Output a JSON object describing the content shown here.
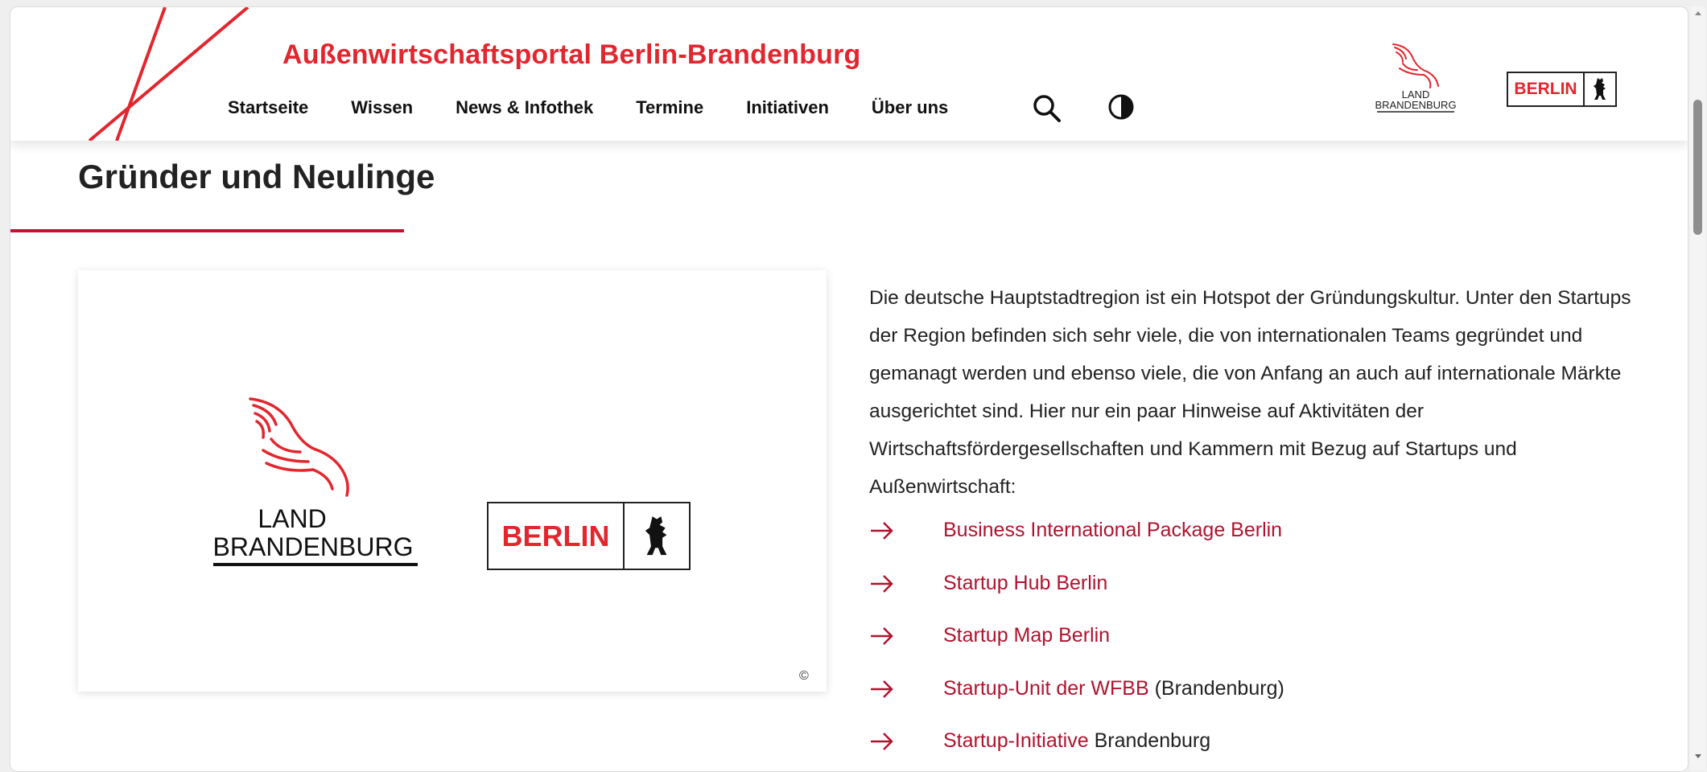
{
  "header": {
    "site_title": "Außenwirtschaftsportal Berlin-Brandenburg",
    "nav": [
      "Startseite",
      "Wissen",
      "News & Infothek",
      "Termine",
      "Initiativen",
      "Über uns"
    ],
    "search_icon": "search-icon",
    "contrast_icon": "contrast-icon",
    "logo_brandenburg": {
      "line1": "LAND",
      "line2": "BRANDENBURG"
    },
    "logo_berlin": {
      "text": "BERLIN",
      "icon": "bear-icon"
    }
  },
  "main": {
    "title": "Gründer und Neulinge",
    "image": {
      "brandenburg_line1": "LAND",
      "brandenburg_line2": "BRANDENBURG",
      "berlin_text": "BERLIN",
      "copyright": "©"
    },
    "intro": "Die deutsche Hauptstadtregion ist ein Hotspot der Gründungskultur. Unter den Startups der Region befinden sich sehr viele, die von internationalen Teams gegründet und gemanagt werden und ebenso viele, die von Anfang an auch auf internationale Märkte ausgerichtet sind. Hier nur ein paar Hinweise auf Aktivitäten der Wirtschaftsfördergesellschaften und Kammern mit Bezug auf Startups und Außenwirtschaft:",
    "links": [
      {
        "text": "Business International Package Berlin",
        "suffix": ""
      },
      {
        "text": "Startup Hub Berlin",
        "suffix": ""
      },
      {
        "text": "Startup Map Berlin",
        "suffix": ""
      },
      {
        "text": "Startup-Unit der WFBB",
        "suffix": " (Brandenburg)"
      },
      {
        "text": "Startup-Initiative",
        "suffix": " Brandenburg"
      }
    ]
  },
  "colors": {
    "brand_red": "#e3262e",
    "link_red": "#b0132e",
    "text": "#222222"
  }
}
